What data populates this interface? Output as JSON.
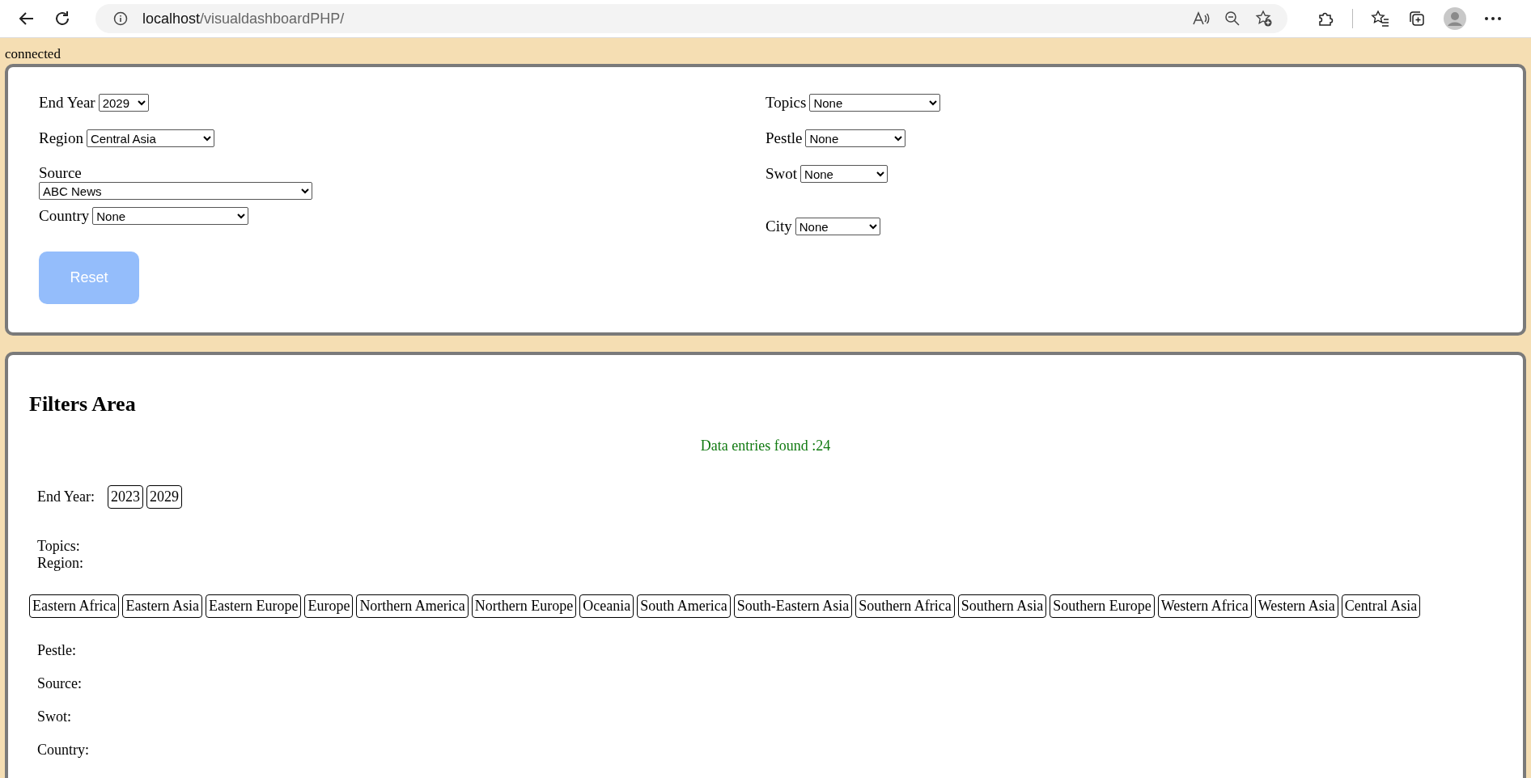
{
  "browser": {
    "url_host": "localhost",
    "url_path": "/visualdashboardPHP/"
  },
  "status": "connected",
  "form": {
    "left": [
      {
        "kind": "inline",
        "label": "End Year",
        "value": "2029"
      },
      {
        "kind": "inline",
        "label": "Region",
        "value": "Central Asia"
      },
      {
        "kind": "stacked",
        "label": "Source",
        "value": "ABC News"
      },
      {
        "kind": "inline",
        "label": "Country",
        "value": "None"
      }
    ],
    "right": [
      {
        "label": "Topics",
        "value": "None"
      },
      {
        "label": "Pestle",
        "value": "None"
      },
      {
        "label": "Swot",
        "value": "None"
      },
      {
        "label": "City",
        "value": "None"
      }
    ],
    "reset_button": {
      "label": "Reset",
      "disabled": true
    }
  },
  "filters": {
    "title": "Filters Area",
    "count_text": "Data entries found :24",
    "groups": [
      {
        "kind": "inline",
        "label": "End Year:",
        "chips": [
          "2023",
          "2029"
        ]
      },
      {
        "kind": "inline",
        "label": "Topics:"
      },
      {
        "kind": "wrapped",
        "label": "Region:",
        "chips": [
          "Eastern Africa",
          "Eastern Asia",
          "Eastern Europe",
          "Europe",
          "Northern America",
          "Northern Europe",
          "Oceania",
          "South America",
          "South-Eastern Asia",
          "Southern Africa",
          "Southern Asia",
          "Southern Europe",
          "Western Africa",
          "Western Asia",
          "Central Asia"
        ]
      },
      {
        "kind": "inline",
        "label": "Pestle:"
      },
      {
        "kind": "inline",
        "label": "Source:"
      },
      {
        "kind": "inline",
        "label": "Swot:"
      },
      {
        "kind": "inline",
        "label": "Country:"
      }
    ]
  }
}
